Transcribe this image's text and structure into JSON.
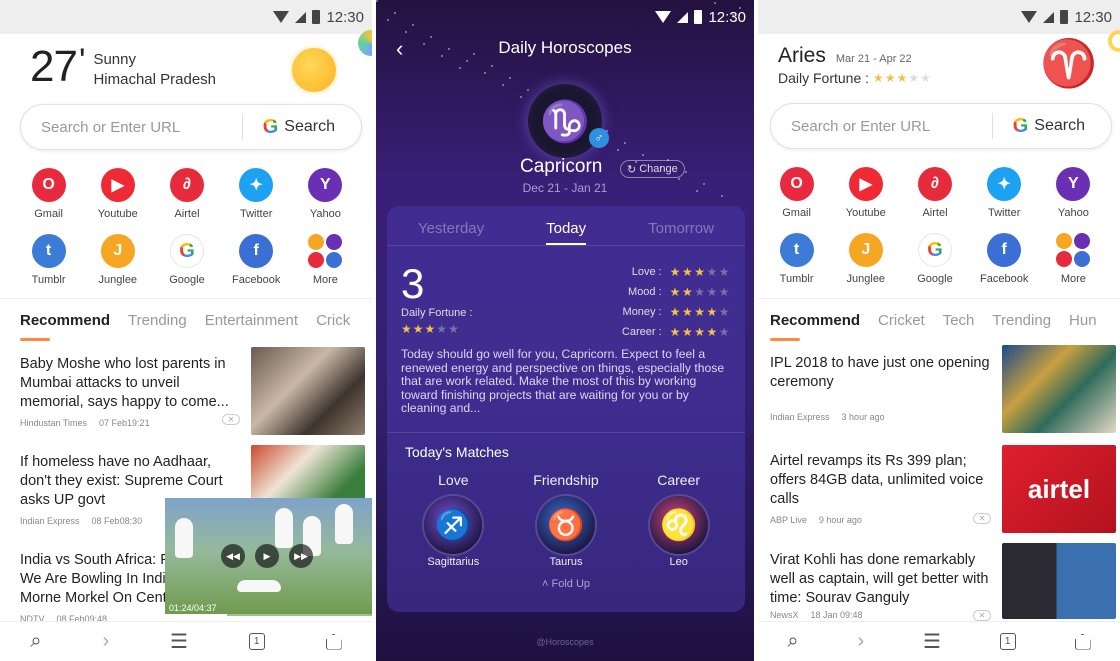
{
  "status": {
    "time": "12:30"
  },
  "browser1": {
    "weather": {
      "temp": "27",
      "deg": "'",
      "condition": "Sunny",
      "location": "Himachal Pradesh"
    },
    "search": {
      "placeholder": "Search or Enter URL",
      "button": "Search"
    },
    "apps": [
      {
        "label": "Gmail",
        "glyph": "O",
        "color": "#e8293e"
      },
      {
        "label": "Youtube",
        "glyph": "▶",
        "color": "#f02a35"
      },
      {
        "label": "Airtel",
        "glyph": "∂",
        "color": "#e62b3c"
      },
      {
        "label": "Twitter",
        "glyph": "✦",
        "color": "#1da1f2"
      },
      {
        "label": "Yahoo",
        "glyph": "Y",
        "color": "#6b2fb3"
      },
      {
        "label": "Tumblr",
        "glyph": "t",
        "color": "#3c7bd6"
      },
      {
        "label": "Junglee",
        "glyph": "J",
        "color": "#f7a624"
      },
      {
        "label": "Google",
        "glyph": "G",
        "color": "#ffffff"
      },
      {
        "label": "Facebook",
        "glyph": "f",
        "color": "#3b6fd6"
      },
      {
        "label": "More",
        "glyph": "",
        "color": ""
      }
    ],
    "tabs": [
      "Recommend",
      "Trending",
      "Entertainment",
      "Crick"
    ],
    "news": [
      {
        "title": "Baby Moshe who lost parents in Mumbai attacks to unveil memorial, says happy to come...",
        "source": "Hindustan Times",
        "time": "07 Feb19:21"
      },
      {
        "title": "If homeless have no Aadhaar, don't they exist: Supreme Court asks UP govt",
        "source": "Indian Express",
        "time": "08 Feb08:30"
      },
      {
        "title": "India vs South Africa: F We Are Bowling In Indi Morne Morkel On Cent",
        "source": "NDTV",
        "time": "08 Feb09:48"
      }
    ],
    "video": {
      "time": "01:24/04:37",
      "progress": 0.3
    },
    "nav_tabs_count": "1"
  },
  "horoscope": {
    "title": "Daily Horoscopes",
    "sign": "Capricorn",
    "sign_glyph": "♑",
    "change": "Change",
    "dates": "Dec 21 - Jan 21",
    "day_tabs": [
      "Yesterday",
      "Today",
      "Tomorrow"
    ],
    "fortune_number": "3",
    "daily_fortune_label": "Daily Fortune :",
    "daily_fortune_stars": 3,
    "ratings": [
      {
        "label": "Love :",
        "stars": 3
      },
      {
        "label": "Mood :",
        "stars": 2
      },
      {
        "label": "Money :",
        "stars": 4
      },
      {
        "label": "Career :",
        "stars": 4
      }
    ],
    "forecast": "Today should go well for you, Capricorn. Expect to feel a renewed energy and perspective on things, especially those that are work related. Make the most of this by working toward finishing projects that are waiting for you or by cleaning and...",
    "matches_title": "Today's Matches",
    "matches": [
      {
        "category": "Love",
        "sign": "Sagittarius",
        "glyph": "♐",
        "color": "#7a4fd8"
      },
      {
        "category": "Friendship",
        "sign": "Taurus",
        "glyph": "♉",
        "color": "#3b6fd6"
      },
      {
        "category": "Career",
        "sign": "Leo",
        "glyph": "♌",
        "color": "#d6457a"
      }
    ],
    "fold_up": "Fold Up",
    "credit": "@Horoscopes"
  },
  "browser2": {
    "sign": "Aries",
    "dates": "Mar 21 - Apr 22",
    "fortune_label": "Daily Fortune :",
    "fortune_stars": 3,
    "sign_glyph": "♈",
    "search": {
      "placeholder": "Search or Enter URL",
      "button": "Search"
    },
    "apps": [
      {
        "label": "Gmail",
        "glyph": "O",
        "color": "#e8293e"
      },
      {
        "label": "Youtube",
        "glyph": "▶",
        "color": "#f02a35"
      },
      {
        "label": "Airtel",
        "glyph": "∂",
        "color": "#e62b3c"
      },
      {
        "label": "Twitter",
        "glyph": "✦",
        "color": "#1da1f2"
      },
      {
        "label": "Yahoo",
        "glyph": "Y",
        "color": "#6b2fb3"
      },
      {
        "label": "Tumblr",
        "glyph": "t",
        "color": "#3c7bd6"
      },
      {
        "label": "Junglee",
        "glyph": "J",
        "color": "#f7a624"
      },
      {
        "label": "Google",
        "glyph": "G",
        "color": "#ffffff"
      },
      {
        "label": "Facebook",
        "glyph": "f",
        "color": "#3b6fd6"
      },
      {
        "label": "More",
        "glyph": "",
        "color": ""
      }
    ],
    "tabs": [
      "Recommend",
      "Cricket",
      "Tech",
      "Trending",
      "Hun"
    ],
    "news": [
      {
        "title": "IPL 2018 to have just one opening ceremony",
        "source": "Indian Express",
        "time": "3 hour ago"
      },
      {
        "title": "Airtel revamps its Rs 399 plan; offers 84GB data, unlimited voice calls",
        "source": "ABP Live",
        "time": "9 hour ago"
      },
      {
        "title": "Virat Kohli has done remarkably well as captain, will get better with time: Sourav Ganguly",
        "source": "NewsX",
        "time": "18 Jan 09:48"
      }
    ],
    "nav_tabs_count": "1"
  }
}
